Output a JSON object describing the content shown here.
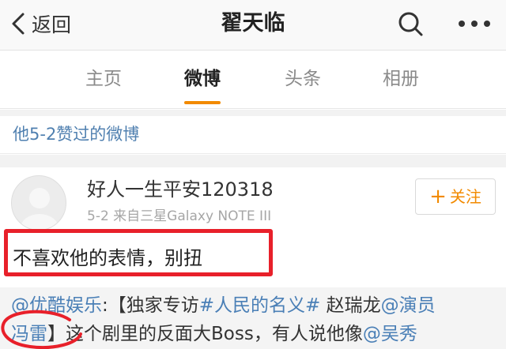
{
  "nav": {
    "back_label": "返回",
    "title": "翟天临",
    "back_icon": "chevron-left-icon",
    "search_icon": "search-icon",
    "more_icon": "more-dots-icon"
  },
  "tabs": [
    {
      "label": "主页"
    },
    {
      "label": "微博",
      "active": true
    },
    {
      "label": "头条"
    },
    {
      "label": "相册"
    }
  ],
  "section_header": "他5-2赞过的微博",
  "post": {
    "username": "好人一生平安120318",
    "meta": "5-2  来自三星Galaxy NOTE III",
    "follow_label": "关注",
    "follow_plus": "+",
    "comment": "不喜欢他的表情，别扭",
    "repost": {
      "mention_source": "@优酷娱乐",
      "colon": ":",
      "bracket_open": "【独家专访",
      "topic": "#人民的名义#",
      "space_name": " 赵瑞龙",
      "mention_actor": "@演员",
      "mention_actor_2": "冯雷",
      "bracket_close": "】",
      "body": "这个剧里的反面大Boss，有人说他像",
      "mention_wu": "@吴秀"
    }
  },
  "colors": {
    "accent": "#f28a00",
    "link": "#4a7fb6",
    "annotation": "#e8202a"
  }
}
